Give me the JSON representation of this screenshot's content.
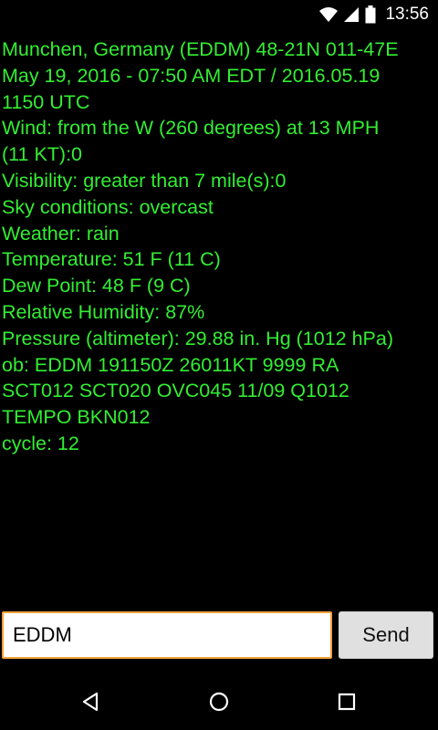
{
  "status_bar": {
    "time": "13:56",
    "icons": [
      "wifi-icon",
      "cell-signal-icon",
      "battery-icon"
    ]
  },
  "report": {
    "lines": [
      "Munchen, Germany (EDDM) 48-21N 011-47E",
      "May 19, 2016 - 07:50 AM EDT / 2016.05.19",
      "1150 UTC",
      "Wind: from the W (260 degrees) at 13 MPH",
      "(11 KT):0",
      "Visibility: greater than 7 mile(s):0",
      "Sky conditions: overcast",
      "Weather: rain",
      "Temperature: 51 F (11 C)",
      "Dew Point: 48 F (9 C)",
      "Relative Humidity: 87%",
      "Pressure (altimeter): 29.88 in. Hg (1012 hPa)",
      "ob: EDDM 191150Z 26011KT 9999 RA",
      "SCT012 SCT020 OVC045 11/09 Q1012",
      "TEMPO BKN012",
      "cycle: 12"
    ],
    "text_color": "#33ee33"
  },
  "input": {
    "value": "EDDM",
    "border_color": "#f4a13a"
  },
  "send_button": {
    "label": "Send"
  },
  "nav_bar": {
    "icons": [
      "back-icon",
      "home-icon",
      "recents-icon"
    ]
  }
}
